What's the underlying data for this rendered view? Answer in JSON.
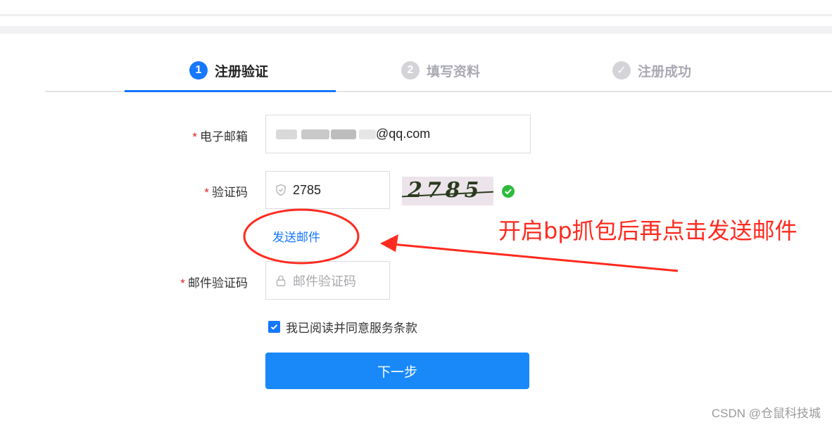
{
  "steps": [
    {
      "num": "1",
      "label": "注册验证",
      "state": "active"
    },
    {
      "num": "2",
      "label": "填写资料",
      "state": "pending"
    },
    {
      "num": "✓",
      "label": "注册成功",
      "state": "pending"
    }
  ],
  "form": {
    "required_mark": "*",
    "email": {
      "label": "电子邮箱",
      "value_suffix": "@qq.com"
    },
    "captcha": {
      "label": "验证码",
      "value": "2785",
      "image_text": "2785",
      "icon": "shield-icon",
      "status_icon": "check-circle-icon"
    },
    "send_mail_link": "发送邮件",
    "mail_code": {
      "label": "邮件验证码",
      "placeholder": "邮件验证码",
      "icon": "lock-icon"
    },
    "agreement": {
      "text": "我已阅读并同意服务条款",
      "checked": true
    },
    "next_button": "下一步"
  },
  "annotation": {
    "text": "开启bp抓包后再点击发送邮件",
    "color": "#ff2a1f"
  },
  "watermark": "CSDN @仓鼠科技城",
  "colors": {
    "primary": "#1677ff",
    "button": "#1989fa",
    "success": "#2dbb3c",
    "required": "#e02020"
  }
}
